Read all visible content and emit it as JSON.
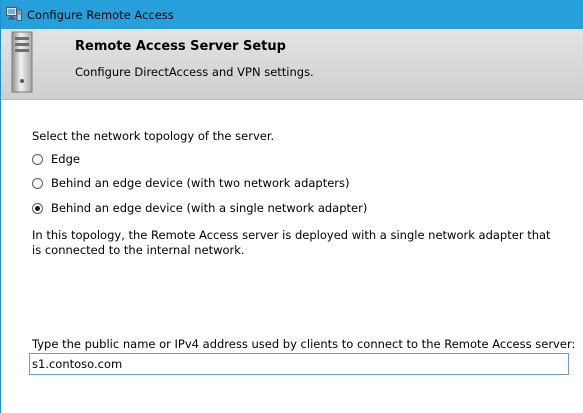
{
  "window": {
    "title": "Configure Remote Access"
  },
  "header": {
    "title": "Remote Access Server Setup",
    "subtitle": "Configure DirectAccess and VPN settings."
  },
  "topology": {
    "prompt": "Select the network topology of the server.",
    "options": [
      {
        "label": "Edge",
        "selected": false
      },
      {
        "label": "Behind an edge device (with two network adapters)",
        "selected": false
      },
      {
        "label": "Behind an edge device (with a single network adapter)",
        "selected": true
      }
    ],
    "description": "In this topology, the Remote Access server is deployed with a single network adapter that is connected to the internal network."
  },
  "public_name": {
    "label": "Type the public name or IPv4 address used by clients to connect to the Remote Access server:",
    "value": "s1.contoso.com"
  },
  "colors": {
    "titlebar": "#26a0da",
    "input_border": "#6a9fd6"
  },
  "icons": {
    "window": "remote-access-window-icon",
    "header": "server-tower-icon"
  }
}
